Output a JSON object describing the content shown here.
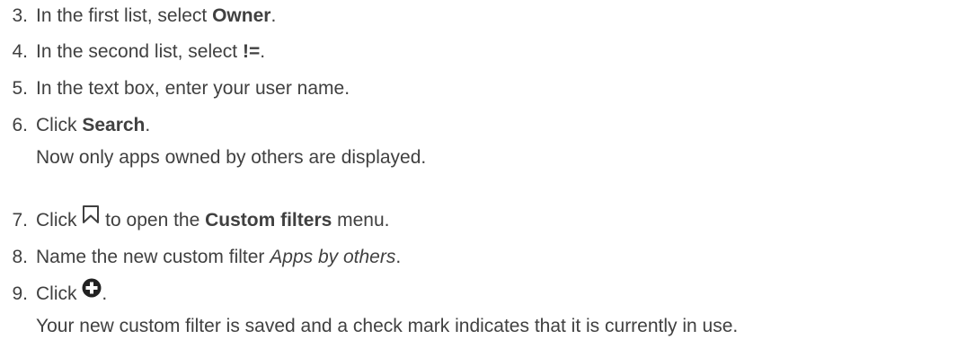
{
  "steps": [
    {
      "number": "3.",
      "pre": "In the first list, select ",
      "strong": "Owner",
      "post": "."
    },
    {
      "number": "4.",
      "pre": "In the second list, select ",
      "strong": "!=",
      "post": "."
    },
    {
      "number": "5.",
      "text": "In the text box, enter your user name."
    },
    {
      "number": "6.",
      "pre": "Click ",
      "strong": "Search",
      "post": ".",
      "result": "Now only apps owned by others are displayed."
    },
    {
      "number": "7.",
      "pre": "Click ",
      "icon": "bookmark-icon",
      "mid": " to open the ",
      "strong": "Custom filters",
      "post": " menu."
    },
    {
      "number": "8.",
      "pre": "Name the new custom filter ",
      "em": "Apps by others",
      "post": "."
    },
    {
      "number": "9.",
      "pre": "Click ",
      "icon": "add-circle-icon",
      "post": ".",
      "result": "Your new custom filter is saved and a check mark indicates that it is currently in use."
    }
  ]
}
